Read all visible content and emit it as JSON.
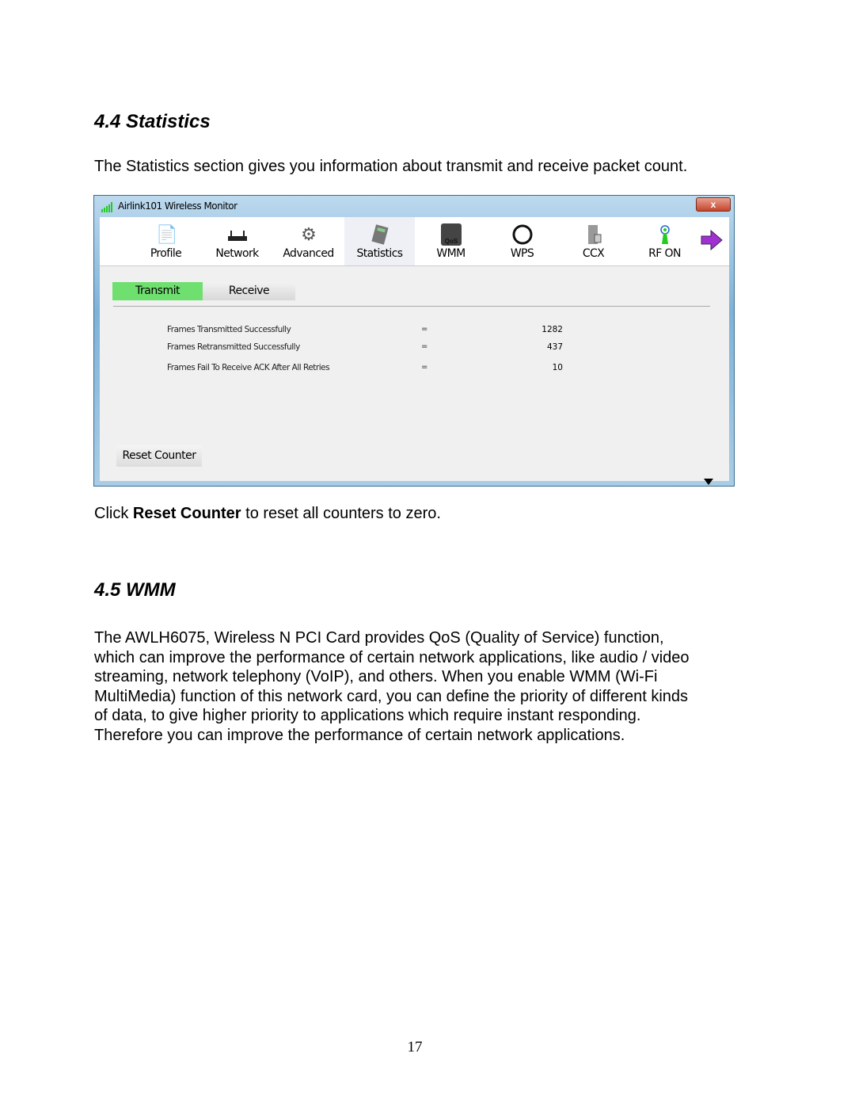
{
  "section1": {
    "heading": "4.4 Statistics",
    "intro": "The Statistics section gives you information about transmit and receive packet count.",
    "note_pre": "Click ",
    "note_bold": "Reset Counter",
    "note_post": " to reset all counters to zero."
  },
  "window": {
    "title": "Airlink101 Wireless Monitor",
    "close_label": "x",
    "toolbar": [
      {
        "label": "Profile",
        "icon": "profile-icon"
      },
      {
        "label": "Network",
        "icon": "router-icon"
      },
      {
        "label": "Advanced",
        "icon": "gears-icon"
      },
      {
        "label": "Statistics",
        "icon": "calculator-icon",
        "selected": true
      },
      {
        "label": "WMM",
        "icon": "qos-icon"
      },
      {
        "label": "WPS",
        "icon": "wps-icon"
      },
      {
        "label": "CCX",
        "icon": "ccx-icon"
      },
      {
        "label": "RF ON",
        "icon": "antenna-icon"
      }
    ],
    "tabs": {
      "transmit": "Transmit",
      "receive": "Receive",
      "active": "Transmit"
    },
    "stats": [
      {
        "label": "Frames Transmitted Successfully",
        "eq": "=",
        "value": "1282"
      },
      {
        "label": "Frames Retransmitted Successfully",
        "eq": "=",
        "value": "437"
      },
      {
        "label": "Frames Fail To Receive ACK After All Retries",
        "eq": "=",
        "value": "10"
      }
    ],
    "reset_label": "Reset Counter",
    "accent": "#6fe06f"
  },
  "section2": {
    "heading": "4.5 WMM",
    "lines": [
      "The AWLH6075, Wireless N PCI Card provides QoS (Quality of Service) function,",
      "which can improve the performance of certain network applications, like audio / video",
      "streaming, network telephony (VoIP), and others. When you enable WMM (Wi-Fi",
      "MultiMedia) function of this network card, you can define the priority of different kinds",
      "of data, to give higher priority to applications which require instant responding.",
      "Therefore you can improve the performance of certain network applications."
    ]
  },
  "page_number": "17"
}
